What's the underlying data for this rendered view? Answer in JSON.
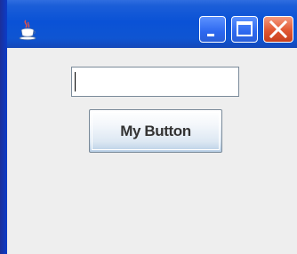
{
  "window": {
    "app_icon": "java-coffee-cup-icon",
    "controls": {
      "minimize_icon": "minimize-icon",
      "maximize_icon": "maximize-icon",
      "close_icon": "close-icon"
    },
    "colors": {
      "titlebar": "#0a52d6",
      "close_button": "#e15732",
      "client_background": "#eeeeee"
    }
  },
  "content": {
    "text_field": {
      "value": "",
      "placeholder": ""
    },
    "button": {
      "label": "My Button"
    }
  }
}
